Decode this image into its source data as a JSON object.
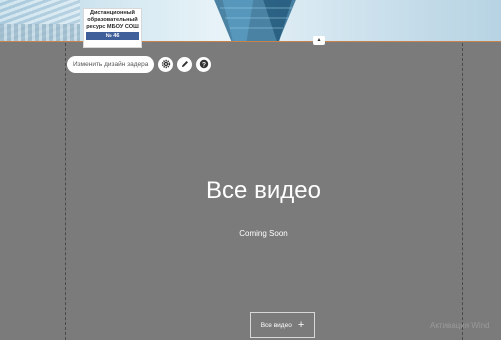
{
  "header": {
    "logo": {
      "lines": [
        "Дистанционный",
        "образовательный",
        "ресурс МБОУ СОШ"
      ],
      "number": "№ 46"
    },
    "collapse_glyph": "▴"
  },
  "toolbar": {
    "design_label": "Изменить дизайн задера",
    "icons": [
      "gear-icon",
      "pencil-icon",
      "help-icon"
    ]
  },
  "content": {
    "title": "Все видео",
    "subtitle": "Coming Soon",
    "button_label": "Все видео",
    "button_plus": "+"
  },
  "watermark": "Активация Wind",
  "colors": {
    "background": "#7b7b7b",
    "header_accent": "#c9834a",
    "logo_bar": "#3f5f9a"
  }
}
